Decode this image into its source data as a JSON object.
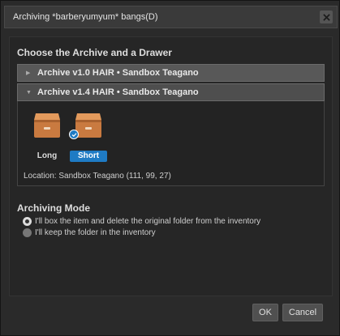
{
  "window": {
    "title": "Archiving *barberyumyum* bangs(D)"
  },
  "archive_section": {
    "heading": "Choose the Archive and a Drawer",
    "archives": [
      {
        "label": "Archive v1.0 HAIR • Sandbox Teagano",
        "expanded": false
      },
      {
        "label": "Archive v1.4 HAIR • Sandbox Teagano",
        "expanded": true
      }
    ],
    "drawers": [
      {
        "label": "Long",
        "selected": false,
        "icon": "drawer-icon"
      },
      {
        "label": "Short",
        "selected": true,
        "icon": "drawer-icon"
      }
    ],
    "location": "Location: Sandbox Teagano (111, 99, 27)"
  },
  "mode_section": {
    "heading": "Archiving Mode",
    "options": [
      {
        "label": "I'll box the item and delete the original folder from the inventory",
        "checked": true
      },
      {
        "label": "I'll keep the folder in the inventory",
        "checked": false
      }
    ]
  },
  "buttons": {
    "ok": "OK",
    "cancel": "Cancel"
  },
  "colors": {
    "accent": "#1f7bc4",
    "drawer": "#c97a40"
  }
}
